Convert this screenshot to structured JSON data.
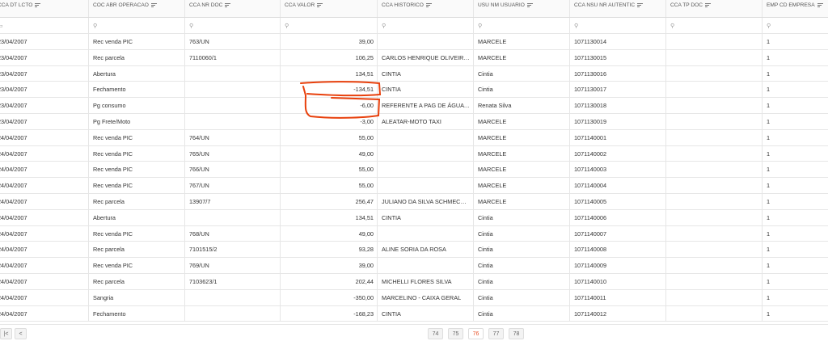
{
  "columns": [
    "CCA DT LCTO",
    "COC ABR OPERACAO",
    "CCA NR DOC",
    "CCA VALOR",
    "CCA HISTORICO",
    "USU NM USUARIO",
    "CCA NSU NR AUTENTIC",
    "CCA TP DOC",
    "EMP CD EMPRESA"
  ],
  "rows": [
    [
      "23/04/2007",
      "Rec venda PIC",
      "763/UN",
      "39,00",
      "",
      "MARCELE",
      "1071130014",
      "",
      "1"
    ],
    [
      "23/04/2007",
      "Rec parcela",
      "7110060/1",
      "106,25",
      "CARLOS HENRIQUE OLIVEIRA CO...",
      "MARCELE",
      "1071130015",
      "",
      "1"
    ],
    [
      "23/04/2007",
      "Abertura",
      "",
      "134,51",
      "CINTIA",
      "Cintia",
      "1071130016",
      "",
      "1"
    ],
    [
      "23/04/2007",
      "Fechamento",
      "",
      "-134,51",
      "CINTIA",
      "Cintia",
      "1071130017",
      "",
      "1"
    ],
    [
      "23/04/2007",
      "Pg consumo",
      "",
      "-6,00",
      "REFERENTE A PAG DE ÁGUA MINE...",
      "Renata Silva",
      "1071130018",
      "",
      "1"
    ],
    [
      "23/04/2007",
      "Pg Frete/Moto",
      "",
      "-3,00",
      "ALEATAR-MOTO TAXI",
      "MARCELE",
      "1071130019",
      "",
      "1"
    ],
    [
      "24/04/2007",
      "Rec venda PIC",
      "764/UN",
      "55,00",
      "",
      "MARCELE",
      "1071140001",
      "",
      "1"
    ],
    [
      "24/04/2007",
      "Rec venda PIC",
      "765/UN",
      "49,00",
      "",
      "MARCELE",
      "1071140002",
      "",
      "1"
    ],
    [
      "24/04/2007",
      "Rec venda PIC",
      "766/UN",
      "55,00",
      "",
      "MARCELE",
      "1071140003",
      "",
      "1"
    ],
    [
      "24/04/2007",
      "Rec venda PIC",
      "767/UN",
      "55,00",
      "",
      "MARCELE",
      "1071140004",
      "",
      "1"
    ],
    [
      "24/04/2007",
      "Rec parcela",
      "13907/7",
      "256,47",
      "JULIANO DA SILVA SCHMECHEL",
      "MARCELE",
      "1071140005",
      "",
      "1"
    ],
    [
      "24/04/2007",
      "Abertura",
      "",
      "134,51",
      "CINTIA",
      "Cintia",
      "1071140006",
      "",
      "1"
    ],
    [
      "24/04/2007",
      "Rec venda PIC",
      "768/UN",
      "49,00",
      "",
      "Cintia",
      "1071140007",
      "",
      "1"
    ],
    [
      "24/04/2007",
      "Rec parcela",
      "7101515/2",
      "93,28",
      "ALINE SORIA DA ROSA",
      "Cintia",
      "1071140008",
      "",
      "1"
    ],
    [
      "24/04/2007",
      "Rec venda PIC",
      "769/UN",
      "39,00",
      "",
      "Cintia",
      "1071140009",
      "",
      "1"
    ],
    [
      "24/04/2007",
      "Rec parcela",
      "7103623/1",
      "202,44",
      "MICHELLI FLORES SILVA",
      "Cintia",
      "1071140010",
      "",
      "1"
    ],
    [
      "24/04/2007",
      "Sangria",
      "",
      "-350,00",
      "MARCELINO - CAIXA GERAL",
      "Cintia",
      "1071140011",
      "",
      "1"
    ],
    [
      "24/04/2007",
      "Fechamento",
      "",
      "-168,23",
      "CINTIA",
      "Cintia",
      "1071140012",
      "",
      "1"
    ]
  ],
  "pager": {
    "first": "|<",
    "prev": "<",
    "pages": [
      "74",
      "75",
      "76",
      "77",
      "78"
    ],
    "current": "76"
  },
  "annotation_color": "#e8400c",
  "accent_color": "#e8542a"
}
